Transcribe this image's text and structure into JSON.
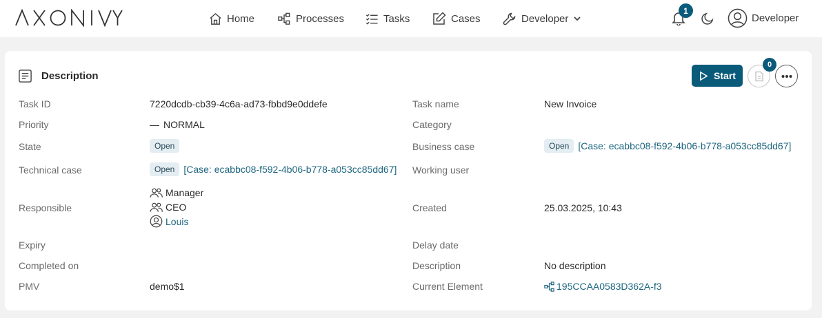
{
  "brand": {
    "logo_text": "AXONIVY"
  },
  "nav": {
    "home": "Home",
    "processes": "Processes",
    "tasks": "Tasks",
    "cases": "Cases",
    "developer": "Developer"
  },
  "notifications": {
    "count": "1"
  },
  "user": {
    "name": "Developer"
  },
  "colors": {
    "accent": "#0a5a7a",
    "link": "#1e6680",
    "chip_bg": "#e3edf2"
  },
  "card": {
    "title": "Description",
    "start_label": "Start",
    "documents_count": "0"
  },
  "details_left": {
    "task_id": {
      "label": "Task ID",
      "value": "7220dcdb-cb39-4c6a-ad73-fbbd9e0ddefe"
    },
    "priority": {
      "label": "Priority",
      "dash": "—",
      "value": "NORMAL"
    },
    "state": {
      "label": "State",
      "value": "Open"
    },
    "technical_case": {
      "label": "Technical case",
      "state": "Open",
      "link": "[Case: ecabbc08-f592-4b06-b778-a053cc85dd67]"
    },
    "responsible": {
      "label": "Responsible",
      "entries": [
        {
          "name": "Manager",
          "icon": "group-icon"
        },
        {
          "name": "CEO",
          "icon": "group-icon"
        },
        {
          "name": "Louis",
          "icon": "user-icon"
        }
      ]
    },
    "expiry": {
      "label": "Expiry",
      "value": ""
    },
    "completed_on": {
      "label": "Completed on",
      "value": ""
    },
    "pmv": {
      "label": "PMV",
      "value": "demo$1"
    }
  },
  "details_right": {
    "task_name": {
      "label": "Task name",
      "value": "New Invoice"
    },
    "category": {
      "label": "Category",
      "value": ""
    },
    "business_case": {
      "label": "Business case",
      "state": "Open",
      "link": "[Case: ecabbc08-f592-4b06-b778-a053cc85dd67]"
    },
    "working_user": {
      "label": "Working user",
      "value": ""
    },
    "created": {
      "label": "Created",
      "value": "25.03.2025, 10:43"
    },
    "delay_date": {
      "label": "Delay date",
      "value": ""
    },
    "description": {
      "label": "Description",
      "value": "No description"
    },
    "current_element": {
      "label": "Current Element",
      "value": "195CCAA0583D362A-f3"
    }
  }
}
